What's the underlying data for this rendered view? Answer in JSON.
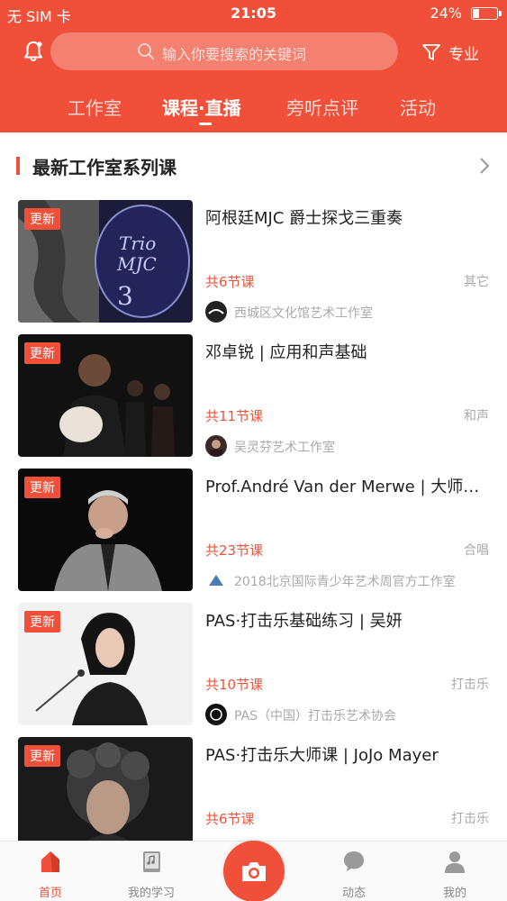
{
  "status_bar": {
    "carrier": "无 SIM 卡",
    "time": "21:05",
    "battery_pct": "24%",
    "battery_level": 0.24
  },
  "header": {
    "search_placeholder": "输入你要搜索的关键词",
    "filter_label": "专业",
    "accent_color": "#f0503a"
  },
  "tabs": [
    {
      "label": "工作室",
      "active": false
    },
    {
      "label": "课程·直播",
      "active": true
    },
    {
      "label": "旁听点评",
      "active": false
    },
    {
      "label": "活动",
      "active": false
    }
  ],
  "section": {
    "title": "最新工作室系列课"
  },
  "courses": [
    {
      "badge": "更新",
      "title": "阿根廷MJC 爵士探戈三重奏",
      "lessons": "共6节课",
      "category": "其它",
      "studio": "西城区文化馆艺术工作室"
    },
    {
      "badge": "更新",
      "title": "邓卓锐 | 应用和声基础",
      "lessons": "共11节课",
      "category": "和声",
      "studio": "吴灵芬艺术工作室"
    },
    {
      "badge": "更新",
      "title": "Prof.André Van der Merwe | 大师…",
      "lessons": "共23节课",
      "category": "合唱",
      "studio": "2018北京国际青少年艺术周官方工作室"
    },
    {
      "badge": "更新",
      "title": "PAS·打击乐基础练习 | 吴妍",
      "lessons": "共10节课",
      "category": "打击乐",
      "studio": "PAS（中国）打击乐艺术协会"
    },
    {
      "badge": "更新",
      "title": "PAS·打击乐大师课 |  JoJo Mayer",
      "lessons": "共6节课",
      "category": "打击乐",
      "studio": ""
    }
  ],
  "tabbar": [
    {
      "label": "首页",
      "icon": "home-icon",
      "active": true
    },
    {
      "label": "我的学习",
      "icon": "book-icon",
      "active": false
    },
    {
      "label": "",
      "icon": "camera-icon",
      "active": false
    },
    {
      "label": "动态",
      "icon": "chat-icon",
      "active": false
    },
    {
      "label": "我的",
      "icon": "user-icon",
      "active": false
    }
  ]
}
